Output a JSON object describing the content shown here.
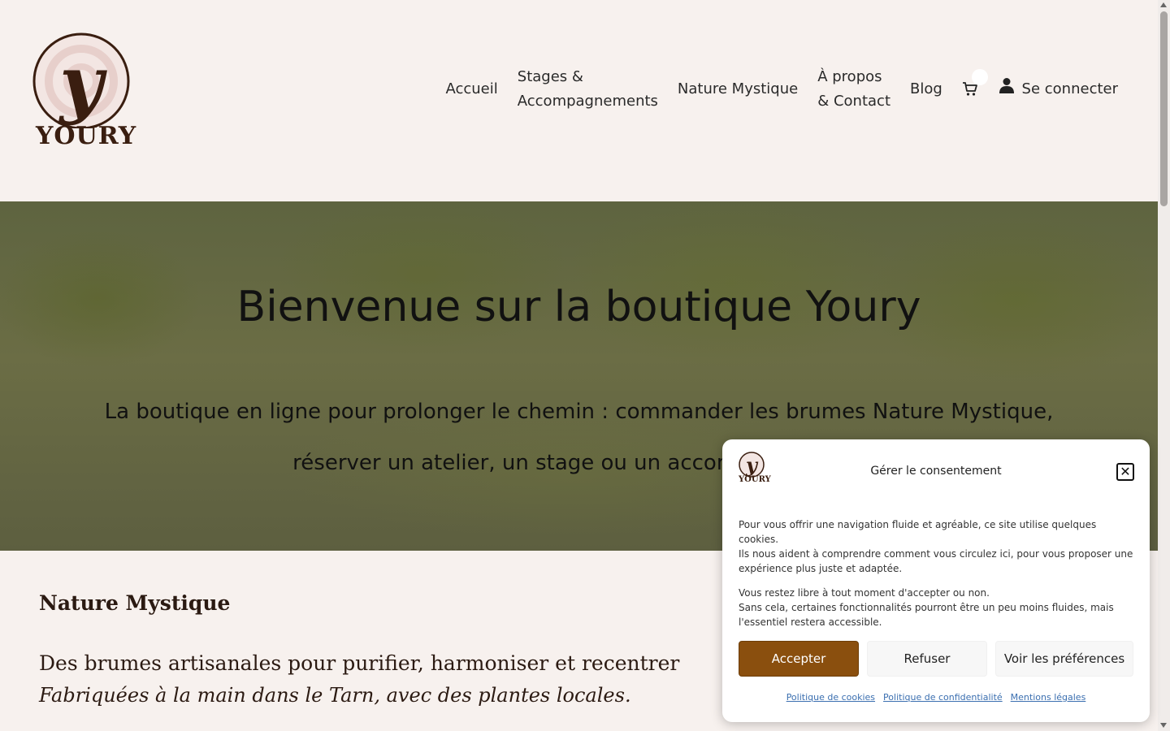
{
  "brand": {
    "name": "YOURY",
    "mark": "y"
  },
  "nav": {
    "items": [
      {
        "label": "Accueil"
      },
      {
        "label": "Stages &",
        "label2": "Accompagnements"
      },
      {
        "label": "Nature Mystique"
      },
      {
        "label": "À propos",
        "label2": "& Contact"
      },
      {
        "label": "Blog"
      }
    ],
    "cart_icon": "cart-icon",
    "login_icon": "user-icon",
    "login_label": "Se connecter"
  },
  "hero": {
    "title": "Bienvenue sur la boutique Youry",
    "subtitle": "La boutique en ligne pour prolonger le chemin : commander les brumes Nature Mystique, réserver un atelier, un stage ou un accompagnement."
  },
  "content": {
    "section_title": "Nature Mystique",
    "lead": "Des brumes artisanales pour purifier, harmoniser et recentrer",
    "lead_italic": "Fabriquées à la main dans le Tarn, avec des plantes locales."
  },
  "consent": {
    "title": "Gérer le consentement",
    "close_icon": "close-icon",
    "paragraph1_line1": "Pour vous offrir une navigation fluide et agréable, ce site utilise quelques cookies.",
    "paragraph1_line2": "Ils nous aident à comprendre comment vous circulez ici, pour vous proposer une expérience plus juste et adaptée.",
    "paragraph2_line1": "Vous restez libre à tout moment d'accepter ou non.",
    "paragraph2_line2": "Sans cela, certaines fonctionnalités pourront être un peu moins fluides, mais l'essentiel restera accessible.",
    "accept_label": "Accepter",
    "refuse_label": "Refuser",
    "prefs_label": "Voir les préférences",
    "links": [
      "Politique de cookies",
      "Politique de confidentialité",
      "Mentions légales"
    ],
    "accent_color": "#8a4f0e"
  }
}
